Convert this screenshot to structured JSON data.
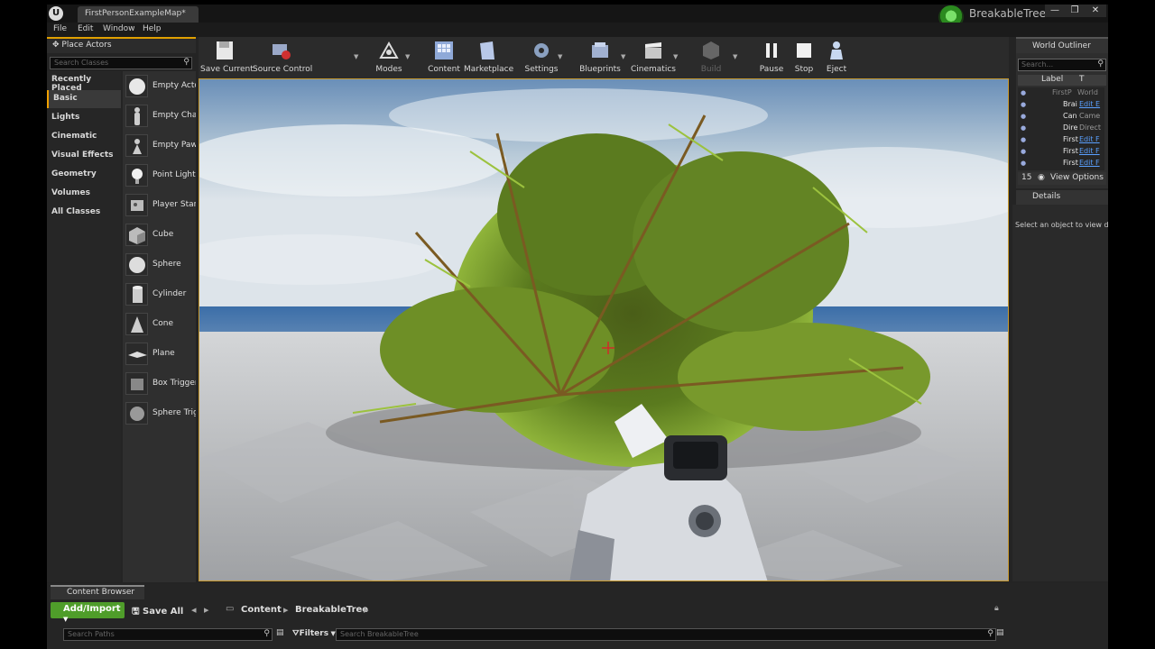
{
  "title_bar": {
    "doc_tab": "FirstPersonExampleMap*",
    "project_name": "BreakableTree",
    "window_buttons": [
      "—",
      "❐",
      "✕"
    ]
  },
  "menu": [
    "File",
    "Edit",
    "Window",
    "Help"
  ],
  "place_actors": {
    "tab_label": "Place Actors",
    "search_placeholder": "Search Classes",
    "categories": [
      {
        "label": "Recently Placed",
        "active": false
      },
      {
        "label": "Basic",
        "active": true
      },
      {
        "label": "Lights",
        "active": false
      },
      {
        "label": "Cinematic",
        "active": false
      },
      {
        "label": "Visual Effects",
        "active": false
      },
      {
        "label": "Geometry",
        "active": false
      },
      {
        "label": "Volumes",
        "active": false
      },
      {
        "label": "All Classes",
        "active": false
      }
    ],
    "actors": [
      {
        "label": "Empty Actor",
        "icon": "sphere-icon"
      },
      {
        "label": "Empty Character",
        "icon": "character-icon"
      },
      {
        "label": "Empty Pawn",
        "icon": "pawn-icon"
      },
      {
        "label": "Point Light",
        "icon": "bulb-icon"
      },
      {
        "label": "Player Start",
        "icon": "player-start-icon"
      },
      {
        "label": "Cube",
        "icon": "cube-icon"
      },
      {
        "label": "Sphere",
        "icon": "sphere-icon"
      },
      {
        "label": "Cylinder",
        "icon": "cylinder-icon"
      },
      {
        "label": "Cone",
        "icon": "cone-icon"
      },
      {
        "label": "Plane",
        "icon": "plane-icon"
      },
      {
        "label": "Box Trigger",
        "icon": "box-trigger-icon"
      },
      {
        "label": "Sphere Trigger",
        "icon": "sphere-trigger-icon"
      }
    ]
  },
  "toolbar": {
    "buttons": [
      {
        "label": "Save Current",
        "icon": "save-icon",
        "color": "#e8e8e8"
      },
      {
        "label": "Source Control",
        "icon": "source-control-icon",
        "color": "#9aa8c8"
      },
      {
        "label": "Modes",
        "icon": "modes-icon",
        "color": "#d8d8d8"
      },
      {
        "label": "Content",
        "icon": "content-icon",
        "color": "#8fa9d8"
      },
      {
        "label": "Marketplace",
        "icon": "marketplace-icon",
        "color": "#b8c8e8"
      },
      {
        "label": "Settings",
        "icon": "settings-icon",
        "color": "#8aa0c0"
      },
      {
        "label": "Blueprints",
        "icon": "blueprints-icon",
        "color": "#a0b0d0"
      },
      {
        "label": "Cinematics",
        "icon": "cinematics-icon",
        "color": "#c8c8c8"
      },
      {
        "label": "Build",
        "icon": "build-icon",
        "color": "#666666"
      },
      {
        "label": "Pause",
        "icon": "pause-icon",
        "color": "#f0f0f0"
      },
      {
        "label": "Stop",
        "icon": "stop-icon",
        "color": "#f0f0f0"
      },
      {
        "label": "Eject",
        "icon": "eject-icon",
        "color": "#c8d8f0"
      }
    ]
  },
  "world_outliner": {
    "tab_label": "World Outliner",
    "search_placeholder": "Search...",
    "col_label": "Label",
    "col_type": "T",
    "rows": [
      {
        "name": "FirstP",
        "type": "World"
      },
      {
        "name": "Brai",
        "type": "Edit E"
      },
      {
        "name": "Can",
        "type": "Came"
      },
      {
        "name": "Dire",
        "type": "Direct"
      },
      {
        "name": "First",
        "type": "Edit F"
      },
      {
        "name": "First",
        "type": "Edit F"
      },
      {
        "name": "First",
        "type": "Edit F"
      }
    ],
    "count": "15",
    "view_options": "View Options"
  },
  "details": {
    "tab_label": "Details",
    "message": "Select an object to view details."
  },
  "content_browser": {
    "tab_label": "Content Browser",
    "add_import": "Add/Import",
    "save_all": "Save All",
    "breadcrumbs": [
      "Content",
      "BreakableTree"
    ],
    "search_paths": "Search Paths",
    "filters": "Filters",
    "search_folder": "Search BreakableTree"
  },
  "colors": {
    "accent": "#e0a000",
    "viewport_border": "#c99a2e",
    "add_button": "#4f9d2a",
    "link": "#5aa0ff"
  }
}
